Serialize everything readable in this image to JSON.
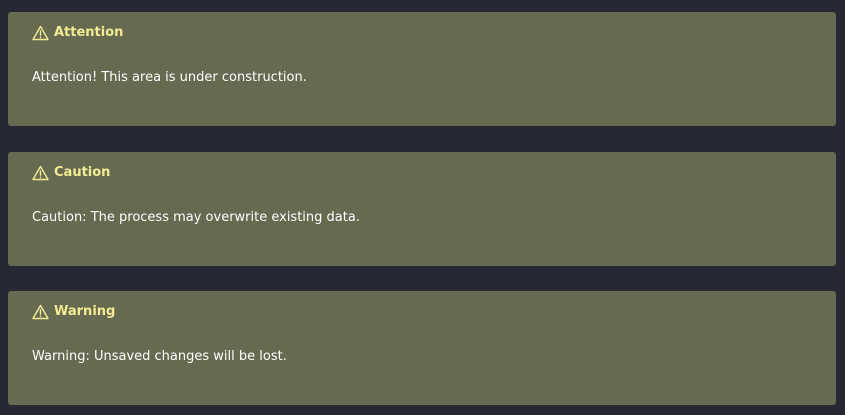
{
  "callouts": [
    {
      "icon": "warning-triangle-icon",
      "title": "Attention",
      "body": "Attention! This area is under construction."
    },
    {
      "icon": "warning-triangle-icon",
      "title": "Caution",
      "body": "Caution: The process may overwrite existing data."
    },
    {
      "icon": "warning-triangle-icon",
      "title": "Warning",
      "body": "Warning: Unsaved changes will be lost."
    }
  ],
  "colors": {
    "page_background": "#262834",
    "callout_background": "#666a50",
    "title_text": "#f2ec94",
    "body_text": "#ffffff"
  }
}
